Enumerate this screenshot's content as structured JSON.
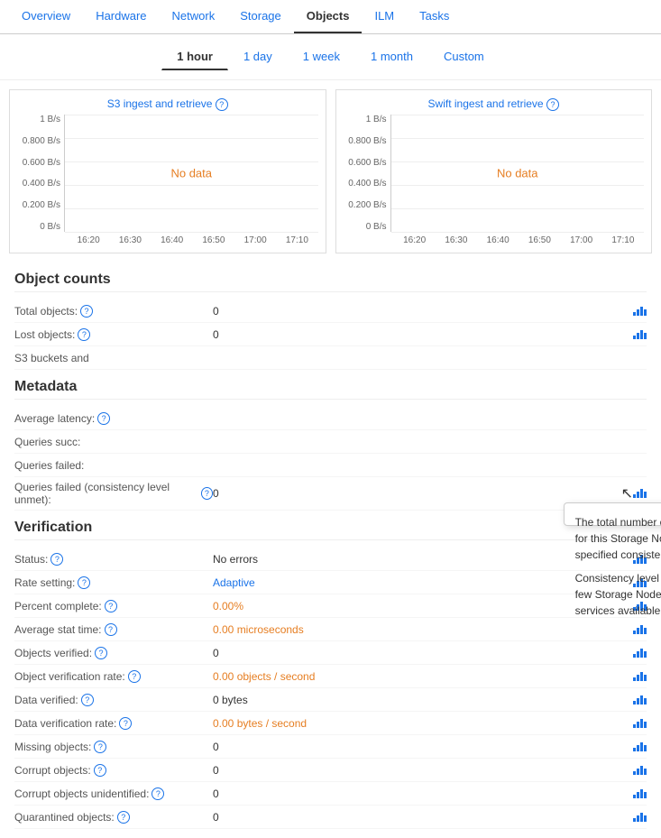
{
  "nav": {
    "items": [
      "Overview",
      "Hardware",
      "Network",
      "Storage",
      "Objects",
      "ILM",
      "Tasks"
    ],
    "active": "Objects"
  },
  "timeTabs": {
    "items": [
      "1 hour",
      "1 day",
      "1 week",
      "1 month",
      "Custom"
    ],
    "active": "1 hour"
  },
  "charts": [
    {
      "title": "S3 ingest and retrieve",
      "yLabels": [
        "1 B/s",
        "0.800 B/s",
        "0.600 B/s",
        "0.400 B/s",
        "0.200 B/s",
        "0 B/s"
      ],
      "xLabels": [
        "16:20",
        "16:30",
        "16:40",
        "16:50",
        "17:00",
        "17:10"
      ],
      "noData": "No data"
    },
    {
      "title": "Swift ingest and retrieve",
      "yLabels": [
        "1 B/s",
        "0.800 B/s",
        "0.600 B/s",
        "0.400 B/s",
        "0.200 B/s",
        "0 B/s"
      ],
      "xLabels": [
        "16:20",
        "16:30",
        "16:40",
        "16:50",
        "17:00",
        "17:10"
      ],
      "noData": "No data"
    }
  ],
  "objectCounts": {
    "title": "Object counts",
    "rows": [
      {
        "label": "Total objects:",
        "value": "0",
        "hasHelp": true,
        "hasChart": true
      },
      {
        "label": "Lost objects:",
        "value": "0",
        "hasHelp": true,
        "hasChart": true
      },
      {
        "label": "S3 buckets and",
        "value": "",
        "hasHelp": false,
        "hasChart": false,
        "truncated": true
      }
    ]
  },
  "metadata": {
    "title": "Metadata",
    "rows": [
      {
        "label": "Average latency:",
        "value": "",
        "hasHelp": true,
        "hasChart": false
      },
      {
        "label": "Queries succ:",
        "value": "",
        "hasHelp": false,
        "hasChart": false
      },
      {
        "label": "Queries failed:",
        "value": "",
        "hasHelp": false,
        "hasChart": false
      },
      {
        "label": "Queries failed (consistency level unmet):",
        "value": "0",
        "hasHelp": true,
        "hasChart": true,
        "hasTooltip": true
      }
    ]
  },
  "tooltip": {
    "para1": "The total number of metadata store queries for this Storage Node that failed to meet a specified consistency level.",
    "para2": "Consistency level failures occur when too few Storage Nodes have metadata store services available."
  },
  "verification": {
    "title": "Verification",
    "rows": [
      {
        "label": "Status:",
        "value": "No errors",
        "valueClass": "",
        "hasHelp": true,
        "hasChart": true
      },
      {
        "label": "Rate setting:",
        "value": "Adaptive",
        "valueClass": "blue",
        "hasHelp": true,
        "hasChart": true
      },
      {
        "label": "Percent complete:",
        "value": "0.00%",
        "valueClass": "orange",
        "hasHelp": true,
        "hasChart": true
      },
      {
        "label": "Average stat time:",
        "value": "0.00 microseconds",
        "valueClass": "orange",
        "hasHelp": true,
        "hasChart": true
      },
      {
        "label": "Objects verified:",
        "value": "0",
        "valueClass": "",
        "hasHelp": true,
        "hasChart": true
      },
      {
        "label": "Object verification rate:",
        "value": "0.00 objects / second",
        "valueClass": "orange",
        "hasHelp": true,
        "hasChart": true
      },
      {
        "label": "Data verified:",
        "value": "0 bytes",
        "valueClass": "",
        "hasHelp": true,
        "hasChart": true
      },
      {
        "label": "Data verification rate:",
        "value": "0.00 bytes / second",
        "valueClass": "orange",
        "hasHelp": true,
        "hasChart": true
      },
      {
        "label": "Missing objects:",
        "value": "0",
        "valueClass": "",
        "hasHelp": true,
        "hasChart": true
      },
      {
        "label": "Corrupt objects:",
        "value": "0",
        "valueClass": "",
        "hasHelp": true,
        "hasChart": true
      },
      {
        "label": "Corrupt objects unidentified:",
        "value": "0",
        "valueClass": "",
        "hasHelp": true,
        "hasChart": true
      },
      {
        "label": "Quarantined objects:",
        "value": "0",
        "valueClass": "",
        "hasHelp": true,
        "hasChart": true
      }
    ]
  },
  "helpIcon": "?",
  "barIconHeights": [
    4,
    7,
    10,
    7
  ]
}
